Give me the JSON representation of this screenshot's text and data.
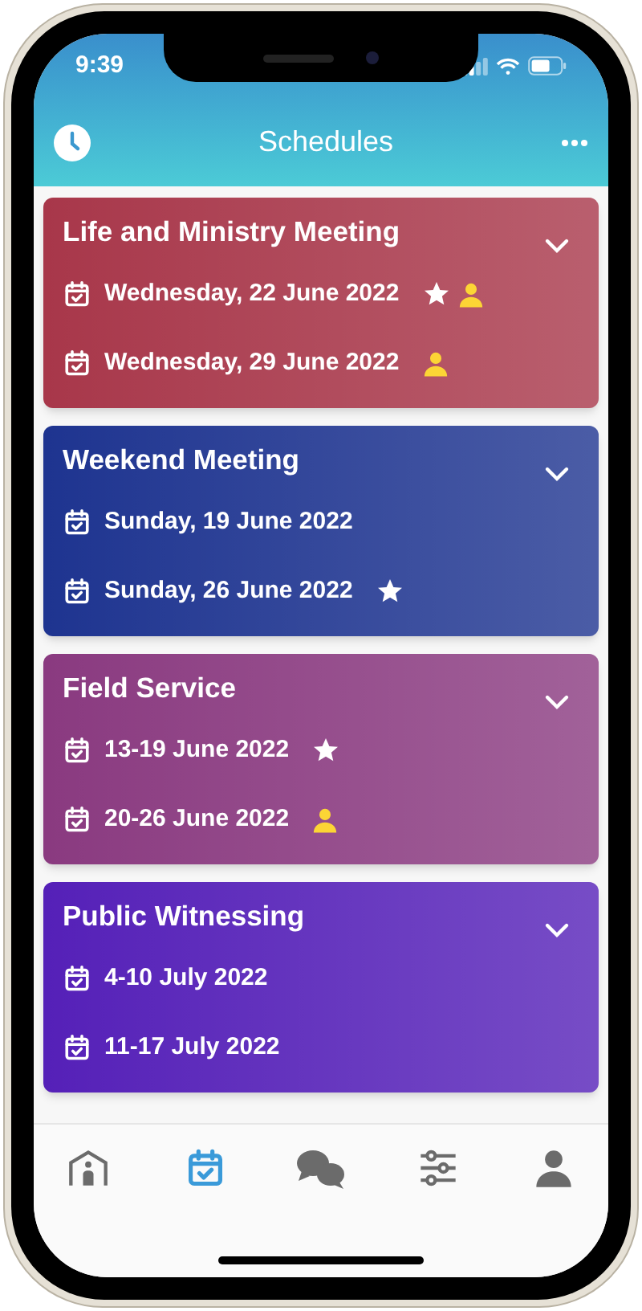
{
  "status_bar": {
    "time": "9:39"
  },
  "header": {
    "title": "Schedules"
  },
  "cards": [
    {
      "title": "Life and Ministry Meeting",
      "color": "#a8374a",
      "expanded": false,
      "dates": [
        {
          "label": "Wednesday, 22 June 2022",
          "star": true,
          "assigned": true
        },
        {
          "label": "Wednesday, 29 June 2022",
          "star": false,
          "assigned": true
        }
      ]
    },
    {
      "title": "Weekend Meeting",
      "color": "#1e3490",
      "expanded": false,
      "dates": [
        {
          "label": "Sunday, 19 June 2022",
          "star": false,
          "assigned": false
        },
        {
          "label": "Sunday, 26 June 2022",
          "star": true,
          "assigned": false
        }
      ]
    },
    {
      "title": "Field Service",
      "color": "#8a3a80",
      "expanded": false,
      "dates": [
        {
          "label": "13-19 June 2022",
          "star": true,
          "assigned": false
        },
        {
          "label": "20-26 June 2022",
          "star": false,
          "assigned": true
        }
      ]
    },
    {
      "title": "Public Witnessing",
      "color": "#5520b8",
      "expanded": false,
      "dates": [
        {
          "label": "4-10 July 2022",
          "star": false,
          "assigned": false
        },
        {
          "label": "11-17 July 2022",
          "star": false,
          "assigned": false
        }
      ]
    }
  ],
  "tab_bar": [
    {
      "kind": "home",
      "selected": false
    },
    {
      "kind": "calendar",
      "selected": true
    },
    {
      "kind": "chat",
      "selected": false
    },
    {
      "kind": "settings",
      "selected": false
    },
    {
      "kind": "profile",
      "selected": false
    }
  ]
}
